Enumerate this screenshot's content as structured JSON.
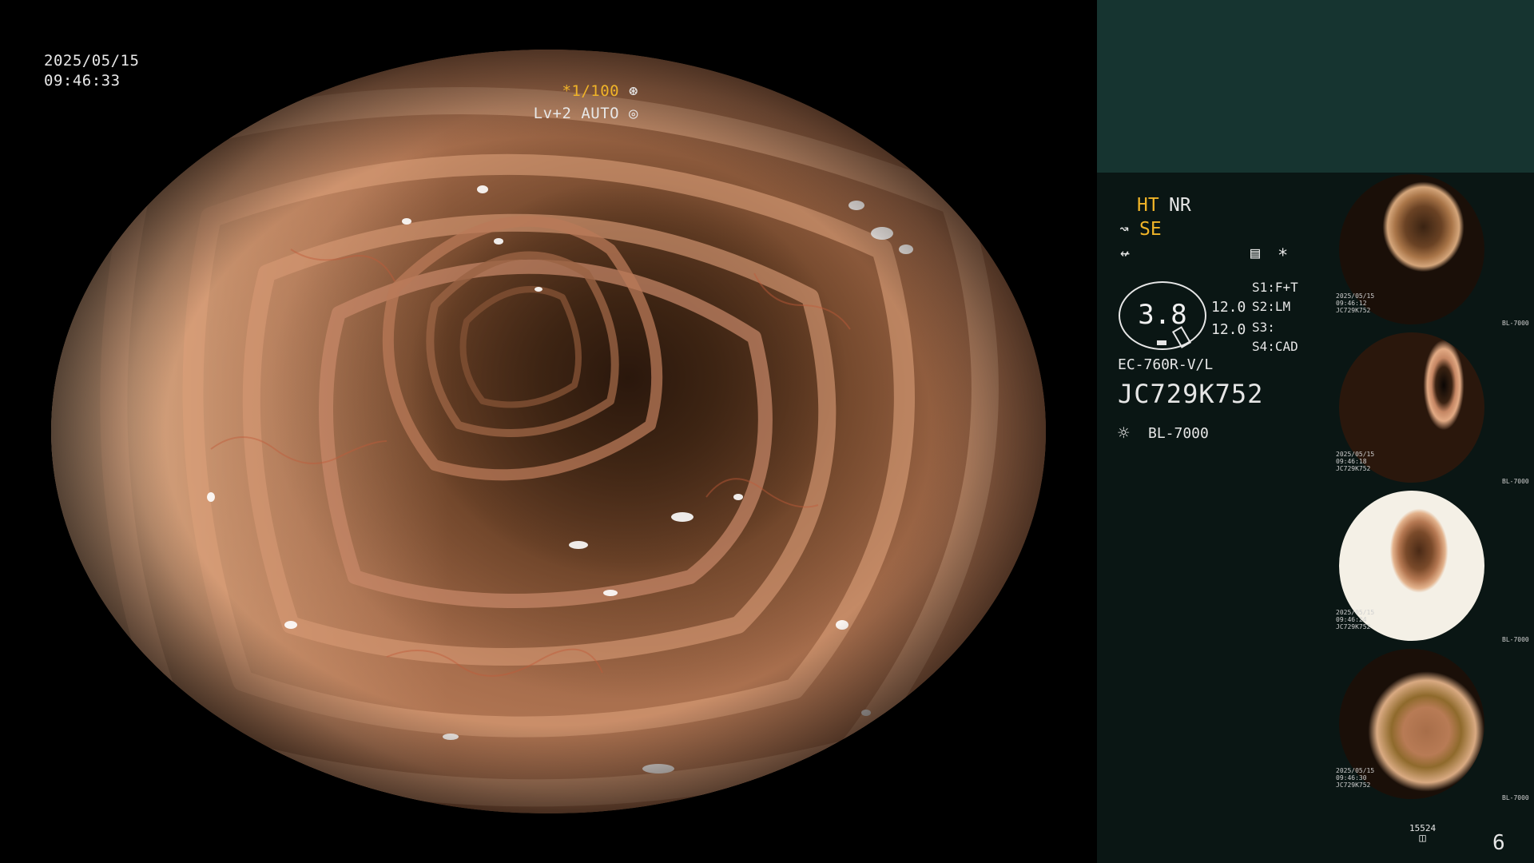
{
  "datetime": {
    "date": "2025/05/15",
    "time": "09:46:33"
  },
  "shutter": {
    "speed": "*1/100",
    "speed_icon": "aperture-icon",
    "level": "Lv+2 AUTO",
    "level_icon": "auto-iris-icon"
  },
  "panel": {
    "modes": {
      "ht": "HT",
      "nr": "NR",
      "se": "SE",
      "se_icon": "structure-enhance-icon",
      "color_icon": "color-mode-icon"
    },
    "right_icons": {
      "table_icon": "scope-table-icon",
      "star": "*"
    },
    "gauge": {
      "value": "3.8",
      "icon": "brightness-gauge-icon"
    },
    "gauge_side": {
      "top": "12.0",
      "bottom": "12.0"
    },
    "switches": [
      "S1:F+T",
      "S2:LM",
      "S3:",
      "S4:CAD"
    ],
    "scope_model": "EC-760R-V/L",
    "serial": "JC729K752",
    "light_icon": "light-source-icon",
    "light_source": "BL-7000",
    "storage": {
      "count": "15524",
      "icon": "storage-icon"
    },
    "captures": "6"
  },
  "thumbnails": [
    {
      "meta": "2025/05/15\n09:46:12\nJC729K752",
      "tag": "BL-7000"
    },
    {
      "meta": "2025/05/15\n09:46:18\nJC729K752",
      "tag": "BL-7000"
    },
    {
      "meta": "2025/05/15\n09:46:24\nJC729K752",
      "tag": "BL-7000"
    },
    {
      "meta": "2025/05/15\n09:46:30\nJC729K752",
      "tag": "BL-7000"
    }
  ],
  "colors": {
    "accent_yellow": "#f0b428",
    "panel_top": "#163430",
    "panel_bg": "#0a1614",
    "text": "#e6e6e6"
  }
}
